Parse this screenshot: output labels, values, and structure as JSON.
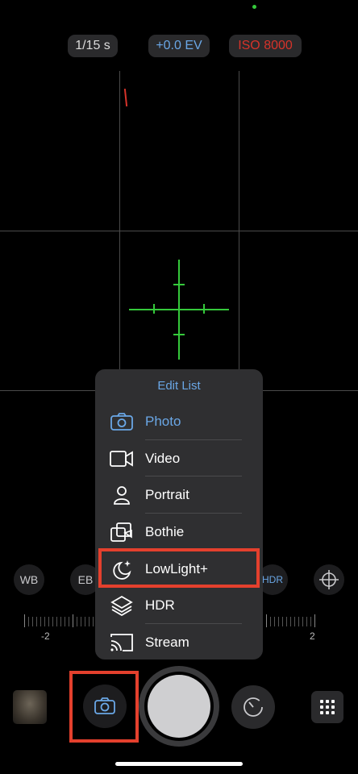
{
  "top": {
    "shutter": "1/15 s",
    "ev": "+0.0 EV",
    "iso": "ISO 8000",
    "colors": {
      "pill_text": "#dcdcdc",
      "ev_text": "#6aa7e6",
      "iso_text": "#d6332a"
    }
  },
  "controls": {
    "wb": "WB",
    "eb": "EB",
    "hdr": "HDR"
  },
  "ruler": {
    "left_value": "-2",
    "right_value": "2"
  },
  "menu": {
    "title": "Edit List",
    "items": [
      {
        "label": "Photo",
        "icon": "camera-icon",
        "selected": true
      },
      {
        "label": "Video",
        "icon": "video-icon"
      },
      {
        "label": "Portrait",
        "icon": "person-icon"
      },
      {
        "label": "Bothie",
        "icon": "bothie-icon"
      },
      {
        "label": "LowLight+",
        "icon": "moon-sparkle-icon",
        "highlighted": true
      },
      {
        "label": "HDR",
        "icon": "layers-icon"
      },
      {
        "label": "Stream",
        "icon": "cast-icon"
      }
    ]
  },
  "colors": {
    "accent": "#6aa7e6",
    "highlight": "#e4402d",
    "crosshair": "#35c93b"
  }
}
